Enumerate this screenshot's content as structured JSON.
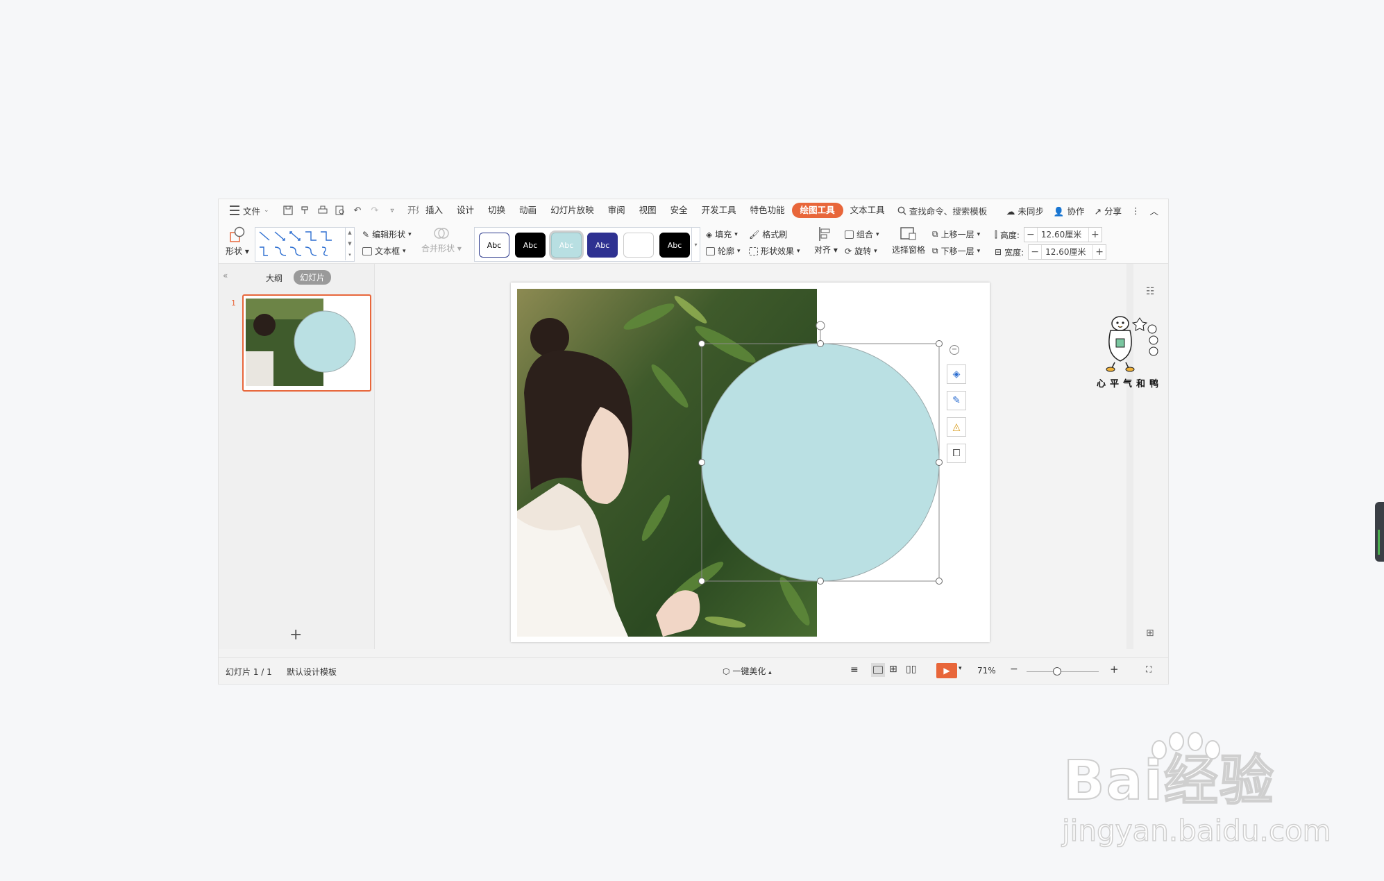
{
  "menu": {
    "file_label": "文件",
    "tabs": [
      "开始",
      "插入",
      "设计",
      "切换",
      "动画",
      "幻灯片放映",
      "审阅",
      "视图",
      "安全",
      "开发工具",
      "特色功能",
      "绘图工具",
      "文本工具"
    ],
    "active_tab": "绘图工具",
    "search_label": "查找命令、搜索模板",
    "sync_label": "未同步",
    "collab_label": "协作",
    "share_label": "分享"
  },
  "ribbon": {
    "shape_label": "形状",
    "edit_shape_label": "编辑形状",
    "textbox_label": "文本框",
    "merge_shape_label": "合并形状",
    "style_swatches": [
      {
        "text": "Abc",
        "bg": "#ffffff",
        "fg": "#000000",
        "border": "#2d3a8c"
      },
      {
        "text": "Abc",
        "bg": "#000000",
        "fg": "#ffffff",
        "border": "#000000"
      },
      {
        "text": "Abc",
        "bg": "#b8dfe2",
        "fg": "#ffffff",
        "border": "#9cc7ca"
      },
      {
        "text": "Abc",
        "bg": "#2e3191",
        "fg": "#ffffff",
        "border": "#2e3191"
      },
      {
        "text": "",
        "bg": "#ffffff",
        "fg": "#000000",
        "border": "#cccccc"
      },
      {
        "text": "Abc",
        "bg": "#000000",
        "fg": "#ffffff",
        "border": "#000000"
      }
    ],
    "fill_label": "填充",
    "format_painter_label": "格式刷",
    "outline_label": "轮廓",
    "shape_effect_label": "形状效果",
    "align_label": "对齐",
    "group_label": "组合",
    "rotate_label": "旋转",
    "selection_pane_label": "选择窗格",
    "bring_forward_label": "上移一层",
    "send_backward_label": "下移一层",
    "height_label": "高度:",
    "height_value": "12.60厘米",
    "width_label": "宽度:",
    "width_value": "12.60厘米"
  },
  "left_pane": {
    "outline_tab": "大纲",
    "slides_tab": "幻灯片",
    "slide_number": "1",
    "add_label": "+"
  },
  "status": {
    "slide_info": "幻灯片 1 / 1",
    "template": "默认设计模板",
    "beautify": "一键美化",
    "zoom": "71%"
  },
  "shape": {
    "fill": "#bae0e3",
    "stroke": "#9aa9ab"
  },
  "watermark": {
    "brand": "Bai经验",
    "domain": "jingyan.baidu.com"
  },
  "sticker_text": "心平气和鸭"
}
